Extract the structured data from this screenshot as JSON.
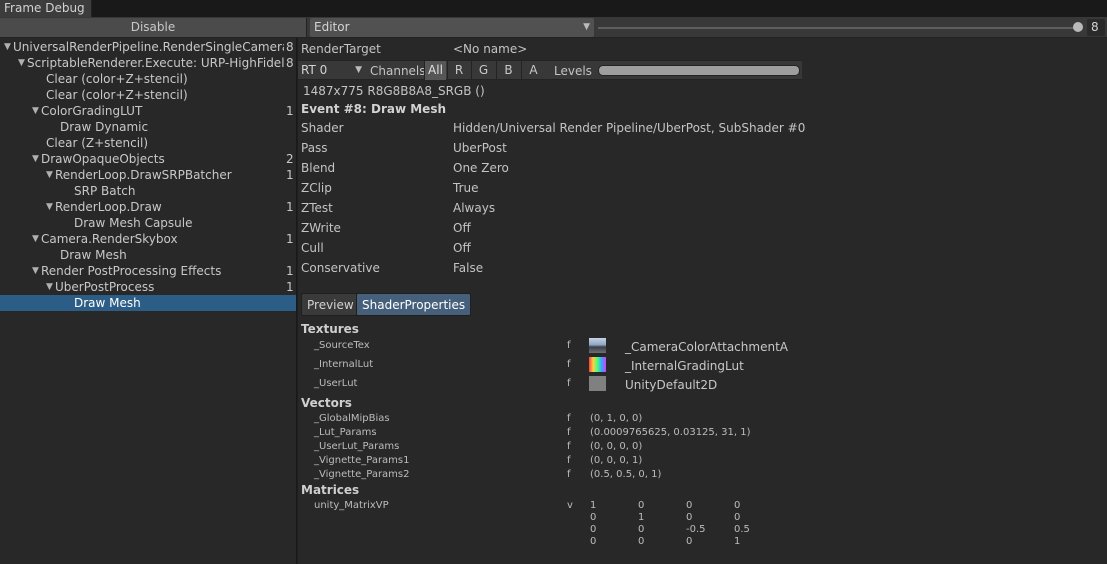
{
  "window": {
    "tab_title": "Frame Debug"
  },
  "toolbar": {
    "disable_label": "Disable",
    "target_value": "Editor",
    "event_index_value": "8"
  },
  "tree": [
    {
      "label": "UniversalRenderPipeline.RenderSingleCamera: M",
      "count": "8",
      "depth": 0,
      "expanded": true,
      "selected": false
    },
    {
      "label": "ScriptableRenderer.Execute: URP-HighFidelity",
      "count": "8",
      "depth": 1,
      "expanded": true,
      "selected": false
    },
    {
      "label": "Clear (color+Z+stencil)",
      "count": "",
      "depth": 2,
      "expanded": null,
      "selected": false
    },
    {
      "label": "Clear (color+Z+stencil)",
      "count": "",
      "depth": 2,
      "expanded": null,
      "selected": false
    },
    {
      "label": "ColorGradingLUT",
      "count": "1",
      "depth": 2,
      "expanded": true,
      "selected": false
    },
    {
      "label": "Draw Dynamic",
      "count": "",
      "depth": 3,
      "expanded": null,
      "selected": false
    },
    {
      "label": "Clear (Z+stencil)",
      "count": "",
      "depth": 2,
      "expanded": null,
      "selected": false
    },
    {
      "label": "DrawOpaqueObjects",
      "count": "2",
      "depth": 2,
      "expanded": true,
      "selected": false
    },
    {
      "label": "RenderLoop.DrawSRPBatcher",
      "count": "1",
      "depth": 3,
      "expanded": true,
      "selected": false
    },
    {
      "label": "SRP Batch",
      "count": "",
      "depth": 4,
      "expanded": null,
      "selected": false
    },
    {
      "label": "RenderLoop.Draw",
      "count": "1",
      "depth": 3,
      "expanded": true,
      "selected": false
    },
    {
      "label": "Draw Mesh Capsule",
      "count": "",
      "depth": 4,
      "expanded": null,
      "selected": false
    },
    {
      "label": "Camera.RenderSkybox",
      "count": "1",
      "depth": 2,
      "expanded": true,
      "selected": false
    },
    {
      "label": "Draw Mesh",
      "count": "",
      "depth": 3,
      "expanded": null,
      "selected": false
    },
    {
      "label": "Render PostProcessing Effects",
      "count": "1",
      "depth": 2,
      "expanded": true,
      "selected": false
    },
    {
      "label": "UberPostProcess",
      "count": "1",
      "depth": 3,
      "expanded": true,
      "selected": false
    },
    {
      "label": "Draw Mesh",
      "count": "",
      "depth": 4,
      "expanded": null,
      "selected": true
    }
  ],
  "render_target": {
    "label": "RenderTarget",
    "value": "<No name>",
    "rt_dropdown": "RT 0",
    "channels_label": "Channels",
    "channels": [
      "All",
      "R",
      "G",
      "B",
      "A"
    ],
    "active_channel": "All",
    "levels_label": "Levels"
  },
  "resolution": "1487x775 R8G8B8A8_SRGB ()",
  "event_title": "Event #8: Draw Mesh",
  "properties": [
    {
      "key": "Shader",
      "value": "Hidden/Universal Render Pipeline/UberPost, SubShader #0"
    },
    {
      "key": "Pass",
      "value": "UberPost"
    },
    {
      "key": "Blend",
      "value": "One Zero"
    },
    {
      "key": "ZClip",
      "value": "True"
    },
    {
      "key": "ZTest",
      "value": "Always"
    },
    {
      "key": "ZWrite",
      "value": "Off"
    },
    {
      "key": "Cull",
      "value": "Off"
    },
    {
      "key": "Conservative",
      "value": "False"
    }
  ],
  "subtabs": {
    "preview": "Preview",
    "shader_properties": "ShaderProperties",
    "active": "ShaderProperties"
  },
  "textures": {
    "title": "Textures",
    "items": [
      {
        "name": "_SourceTex",
        "stage": "f",
        "value": "_CameraColorAttachmentA"
      },
      {
        "name": "_InternalLut",
        "stage": "f",
        "value": "_InternalGradingLut"
      },
      {
        "name": "_UserLut",
        "stage": "f",
        "value": "UnityDefault2D"
      }
    ]
  },
  "vectors": {
    "title": "Vectors",
    "items": [
      {
        "name": "_GlobalMipBias",
        "stage": "f",
        "value": "(0, 1, 0, 0)"
      },
      {
        "name": "_Lut_Params",
        "stage": "f",
        "value": "(0.0009765625, 0.03125, 31, 1)"
      },
      {
        "name": "_UserLut_Params",
        "stage": "f",
        "value": "(0, 0, 0, 0)"
      },
      {
        "name": "_Vignette_Params1",
        "stage": "f",
        "value": "(0, 0, 0, 1)"
      },
      {
        "name": "_Vignette_Params2",
        "stage": "f",
        "value": "(0.5, 0.5, 0, 1)"
      }
    ]
  },
  "matrices": {
    "title": "Matrices",
    "items": [
      {
        "name": "unity_MatrixVP",
        "stage": "v",
        "rows": [
          [
            "1",
            "0",
            "0",
            "0"
          ],
          [
            "0",
            "1",
            "0",
            "0"
          ],
          [
            "0",
            "0",
            "-0.5",
            "0.5"
          ],
          [
            "0",
            "0",
            "0",
            "1"
          ]
        ]
      }
    ]
  }
}
